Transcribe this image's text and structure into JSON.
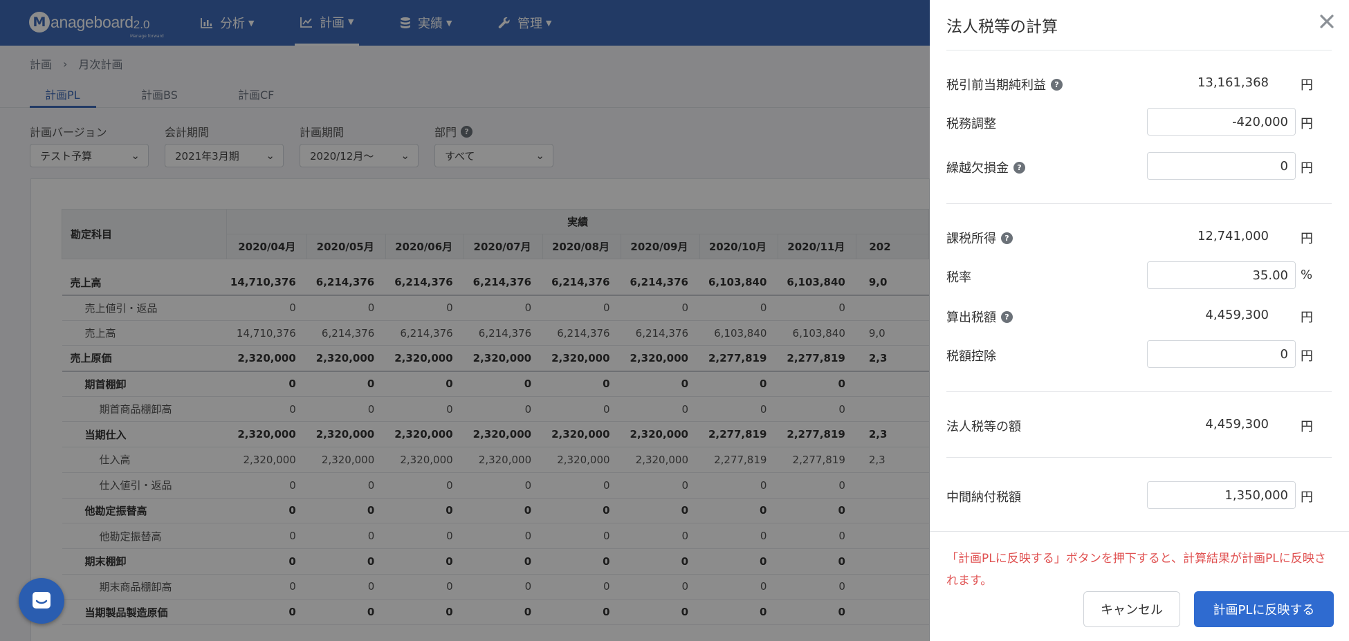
{
  "nav": {
    "logo": {
      "text": "anageboard",
      "version": "2.0",
      "sub": "Manage forward"
    },
    "items": [
      {
        "label": "分析",
        "icon": "bar-chart-icon"
      },
      {
        "label": "計画",
        "icon": "line-chart-icon"
      },
      {
        "label": "実績",
        "icon": "database-icon"
      },
      {
        "label": "管理",
        "icon": "wrench-icon"
      }
    ],
    "active": "計画"
  },
  "breadcrumb": {
    "root": "計画",
    "current": "月次計画"
  },
  "tabs": [
    {
      "label": "計画PL",
      "active": true
    },
    {
      "label": "計画BS",
      "active": false
    },
    {
      "label": "計画CF",
      "active": false
    }
  ],
  "filters": [
    {
      "label": "計画バージョン",
      "value": "テスト予算"
    },
    {
      "label": "会計期間",
      "value": "2021年3月期"
    },
    {
      "label": "計画期間",
      "value": "2020/12月～"
    },
    {
      "label": "部門",
      "value": "すべて"
    }
  ],
  "table": {
    "account_header": "勘定科目",
    "group_header": "実績",
    "months": [
      "2020/04月",
      "2020/05月",
      "2020/06月",
      "2020/07月",
      "2020/08月",
      "2020/09月",
      "2020/10月",
      "2020/11月",
      "202"
    ],
    "rows": [
      {
        "label": "売上高",
        "values": [
          "14,710,376",
          "6,214,376",
          "6,214,376",
          "6,214,376",
          "6,214,376",
          "6,214,376",
          "6,103,840",
          "6,103,840",
          "9,0"
        ]
      },
      {
        "label": "売上値引・返品",
        "values": [
          "0",
          "0",
          "0",
          "0",
          "0",
          "0",
          "0",
          "0",
          ""
        ]
      },
      {
        "label": "売上高",
        "values": [
          "14,710,376",
          "6,214,376",
          "6,214,376",
          "6,214,376",
          "6,214,376",
          "6,214,376",
          "6,103,840",
          "6,103,840",
          "9,0"
        ]
      },
      {
        "label": "売上原価",
        "values": [
          "2,320,000",
          "2,320,000",
          "2,320,000",
          "2,320,000",
          "2,320,000",
          "2,320,000",
          "2,277,819",
          "2,277,819",
          "2,3"
        ]
      },
      {
        "label": "期首棚卸",
        "values": [
          "0",
          "0",
          "0",
          "0",
          "0",
          "0",
          "0",
          "0",
          ""
        ]
      },
      {
        "label": "期首商品棚卸高",
        "values": [
          "0",
          "0",
          "0",
          "0",
          "0",
          "0",
          "0",
          "0",
          ""
        ]
      },
      {
        "label": "当期仕入",
        "values": [
          "2,320,000",
          "2,320,000",
          "2,320,000",
          "2,320,000",
          "2,320,000",
          "2,320,000",
          "2,277,819",
          "2,277,819",
          "2,3"
        ]
      },
      {
        "label": "仕入高",
        "values": [
          "2,320,000",
          "2,320,000",
          "2,320,000",
          "2,320,000",
          "2,320,000",
          "2,320,000",
          "2,277,819",
          "2,277,819",
          "2,3"
        ]
      },
      {
        "label": "仕入値引・返品",
        "values": [
          "0",
          "0",
          "0",
          "0",
          "0",
          "0",
          "0",
          "0",
          ""
        ]
      },
      {
        "label": "他勘定振替高",
        "values": [
          "0",
          "0",
          "0",
          "0",
          "0",
          "0",
          "0",
          "0",
          ""
        ]
      },
      {
        "label": "他勘定振替高",
        "values": [
          "0",
          "0",
          "0",
          "0",
          "0",
          "0",
          "0",
          "0",
          ""
        ]
      },
      {
        "label": "期末棚卸",
        "values": [
          "0",
          "0",
          "0",
          "0",
          "0",
          "0",
          "0",
          "0",
          ""
        ]
      },
      {
        "label": "期末商品棚卸高",
        "values": [
          "0",
          "0",
          "0",
          "0",
          "0",
          "0",
          "0",
          "0",
          ""
        ]
      },
      {
        "label": "当期製品製造原価",
        "values": [
          "0",
          "0",
          "0",
          "0",
          "0",
          "0",
          "0",
          "0",
          ""
        ]
      }
    ]
  },
  "panel": {
    "title": "法人税等の計算",
    "pretax_income": {
      "label": "税引前当期純利益",
      "value": "13,161,368",
      "unit": "円"
    },
    "tax_adjustment": {
      "label": "税務調整",
      "value": "-420,000",
      "unit": "円"
    },
    "loss_carryforward": {
      "label": "繰越欠損金",
      "value": "0",
      "unit": "円"
    },
    "taxable_income": {
      "label": "課税所得",
      "value": "12,741,000",
      "unit": "円"
    },
    "tax_rate": {
      "label": "税率",
      "value": "35.00",
      "unit": "%"
    },
    "computed_tax": {
      "label": "算出税額",
      "value": "4,459,300",
      "unit": "円"
    },
    "tax_credit": {
      "label": "税額控除",
      "value": "0",
      "unit": "円"
    },
    "corporate_tax": {
      "label": "法人税等の額",
      "value": "4,459,300",
      "unit": "円"
    },
    "interim_tax": {
      "label": "中間納付税額",
      "value": "1,350,000",
      "unit": "円"
    },
    "notice": "「計画PLに反映する」ボタンを押下すると、計算結果が計画PLに反映されます。",
    "cancel_label": "キャンセル",
    "apply_label": "計画PLに反映する",
    "help_glyph": "?"
  },
  "colors": {
    "brand": "#3f6bb8",
    "primary_button": "#2f6bd0",
    "notice": "#e05252",
    "chat": "#2a5db0"
  }
}
